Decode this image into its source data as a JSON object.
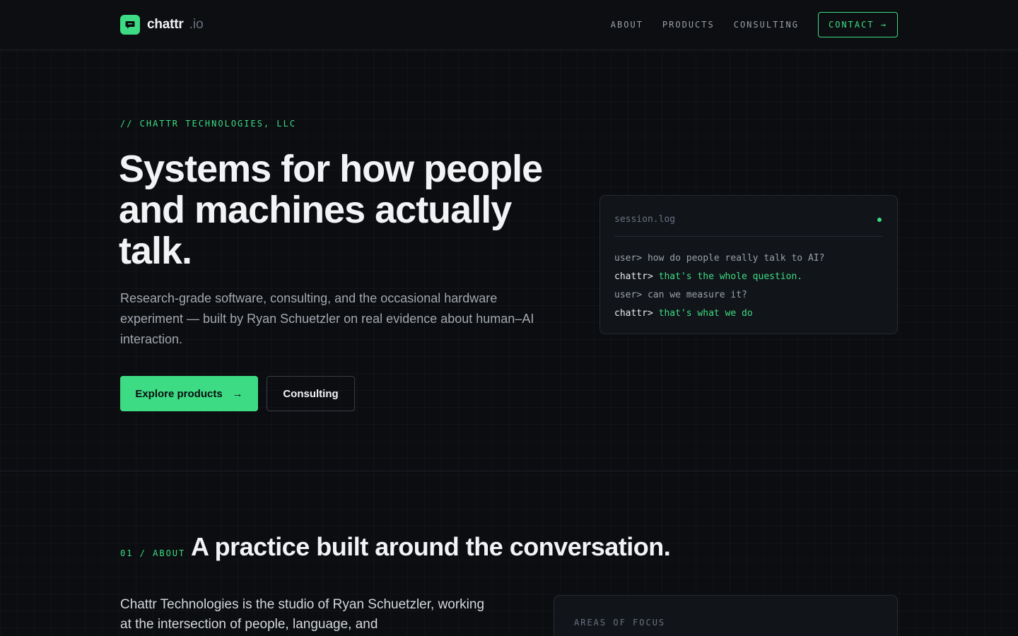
{
  "nav": {
    "brand_name": "chattr",
    "brand_tld": ".io",
    "links": [
      {
        "label": "ABOUT"
      },
      {
        "label": "PRODUCTS"
      },
      {
        "label": "CONSULTING"
      }
    ],
    "contact_label": "CONTACT →"
  },
  "hero": {
    "eyebrow": "// CHATTR TECHNOLOGIES, LLC",
    "title": "Systems for how people and machines actually talk.",
    "subtitle": "Research-grade software, consulting, and the occasional hardware experiment — built by Ryan Schuetzler on real evidence about human–AI interaction.",
    "primary_button": "Explore products",
    "primary_button_arrow": "→",
    "secondary_button": "Consulting"
  },
  "terminal": {
    "title": "session.log",
    "lines": [
      {
        "prompt": "user>",
        "text": "how do people really talk to AI?",
        "speaker": "user"
      },
      {
        "prompt": "chattr>",
        "text": "that's the whole question.",
        "speaker": "bot"
      },
      {
        "prompt": "user>",
        "text": "can we measure it?",
        "speaker": "user"
      },
      {
        "prompt": "chattr>",
        "text": "that's what we do",
        "speaker": "bot"
      }
    ]
  },
  "about": {
    "eyebrow": "01 / ABOUT",
    "title": "A practice built around the conversation.",
    "body": "Chattr Technologies is the studio of Ryan Schuetzler, working at the intersection of people, language, and",
    "focus_label": "AREAS OF FOCUS"
  },
  "colors": {
    "accent": "#3ddc84",
    "background": "#0b0d10",
    "surface": "#111419",
    "text_primary": "#f1f3f5",
    "text_muted": "#a3a9b0"
  },
  "icons": {
    "logo": "chat-bubble-icon",
    "status": "status-dot-icon"
  }
}
